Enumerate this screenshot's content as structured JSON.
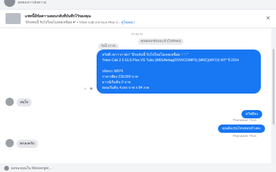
{
  "top": {
    "name": "ผลของการส่งความ"
  },
  "header": {
    "title": "แชทนี้มีข้อความตอบกลับที่บันทึกไว้ของคุณ",
    "subtitle": "\"มีรถคันนี้ รับไปใหม่ไม่เคยเหนื่อย ♥\" ▪ Triton Cab 2.5 GLS Plus V...",
    "link": "ดูโฆษณา",
    "close": "✕"
  },
  "chat": {
    "stamp_top": "17:31 น.",
    "reply_pill": "คุณตอบกลับแนะนำ(ไฟล์หลง)",
    "stamp2": "วันนี้ 17:31",
    "ad_lines": [
      "สวัสดี เขาวากาต่ะ! \"มีรถคันนี้ รับไปใหม่ไม่เคยเหนื่อย ♡♡\"",
      "Triton Cab 2.5 GLS Plus VG Tubo (ABS/Airbag/DVD/CD/MP3) (MNC)(MY10) MT* ปี 2014",
      "",
      "รหัสรถ: M074",
      "ราคาเพียง 239,000 บาท",
      "ดาวน์เริ่มต้น 0 บาท",
      "ผ่อนเริ่มต้น 4,xxx บาท x 84 งวด"
    ],
    "msg_in1": "สนใจ",
    "msg_out1": "สวัสดีคะ",
    "sender1": "Thanawan Thon",
    "msg_out2": "คุณต้องรุ่นไหนชอบบ้างคะ",
    "sender2": "Thanawan Thon",
    "msg_in2": "ตกลงครับ"
  },
  "footer": {
    "text": "ผลของคุณใน Messenger..."
  }
}
